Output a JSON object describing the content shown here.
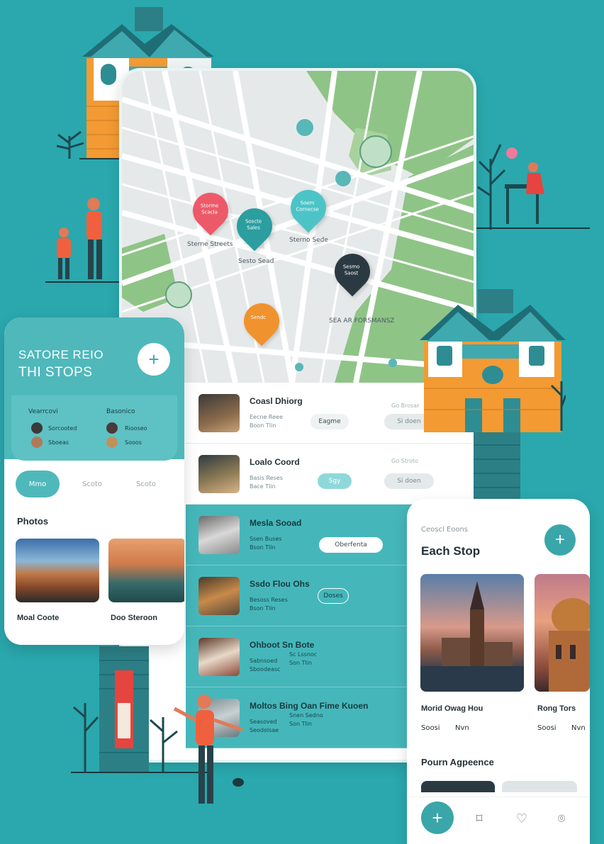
{
  "theme": {
    "background": "#2aa8ad",
    "accent": "#3aa6a9",
    "pin_red": "#ec5a6a",
    "pin_teal": "#2c9ea0",
    "pin_cyan": "#4cc4c7",
    "pin_dark": "#2b3a42",
    "pin_orange": "#f0922e",
    "house_orange": "#f39a33"
  },
  "map": {
    "labels": [
      "Sterne Streets",
      "Sterno Sede",
      "Sesto Sead",
      "SEA AR FORSMANSZ"
    ],
    "pins": [
      {
        "text": "Storme Scacla",
        "color": "#ec5a6a"
      },
      {
        "text": "Soscte Sales",
        "color": "#2c9ea0"
      },
      {
        "text": "Soem Cornecse",
        "color": "#4cc4c7"
      },
      {
        "text": "Sesmo Saost",
        "color": "#2b3a42"
      },
      {
        "text": "Sendc",
        "color": "#f0922e"
      }
    ]
  },
  "stops": [
    {
      "title": "Coasl Dhiorg",
      "meta1": "Eecne Reee",
      "meta2": "Boon Tlin",
      "chip1": "Eagme",
      "chip2": "Si doen",
      "note": "Go Brosar"
    },
    {
      "title": "Loalo Coord",
      "meta1": "Basis Reses",
      "meta2": "Bace Tlin",
      "chip1": "Sgy",
      "chip2": "Si doen",
      "note": "Go Stroto"
    },
    {
      "title": "Mesla Sooad",
      "meta1": "Ssen Buses",
      "meta2": "Bson Tlin",
      "chip1": "Oberfenta"
    },
    {
      "title": "Ssdo Flou Ohs",
      "meta1": "Besoss Reses",
      "meta2": "Bson Tlin",
      "chip1": "Doses"
    },
    {
      "title": "Ohboot Sn Bote",
      "meta1": "Sabnsoed",
      "meta2": "Sboodeasc",
      "meta3": "Sc Lssnoc",
      "meta4": "Son Tlin"
    },
    {
      "title": "Moltos Bing Oan Fime Kuoen",
      "meta1": "Seasoved",
      "meta2": "Seodolsae",
      "meta3": "Snen Sedno",
      "meta4": "Son Tlin"
    }
  ],
  "left_card": {
    "title_line1": "SATORE REIO",
    "title_line2": "THI STOPS",
    "plus": "+",
    "col1": {
      "heading": "Vearrcovi",
      "names": [
        "Sorcooted",
        "Sboeas"
      ]
    },
    "col2": {
      "heading": "Basonico",
      "names": [
        "Riooseo",
        "Sooos"
      ]
    },
    "segments": [
      "Mmo",
      "Scoto",
      "Scoto"
    ],
    "photos_label": "Photos",
    "photo_captions": [
      "Moal Coote",
      "Doo Steroon"
    ]
  },
  "right_card": {
    "kicker": "Ceoscl Eoons",
    "title": "Each Stop",
    "plus": "+",
    "items": [
      {
        "caption": "Morid Owag Hou",
        "meta1": "Soosi",
        "meta2": "Nvn"
      },
      {
        "caption": "Rong Tors",
        "meta1": "Soosi",
        "meta2": "Nvn"
      }
    ],
    "section": "Pourn Agpeence",
    "nav": {
      "plus": "+",
      "bookmark": "⌑",
      "heart": "♡",
      "pin": "⌾"
    }
  }
}
